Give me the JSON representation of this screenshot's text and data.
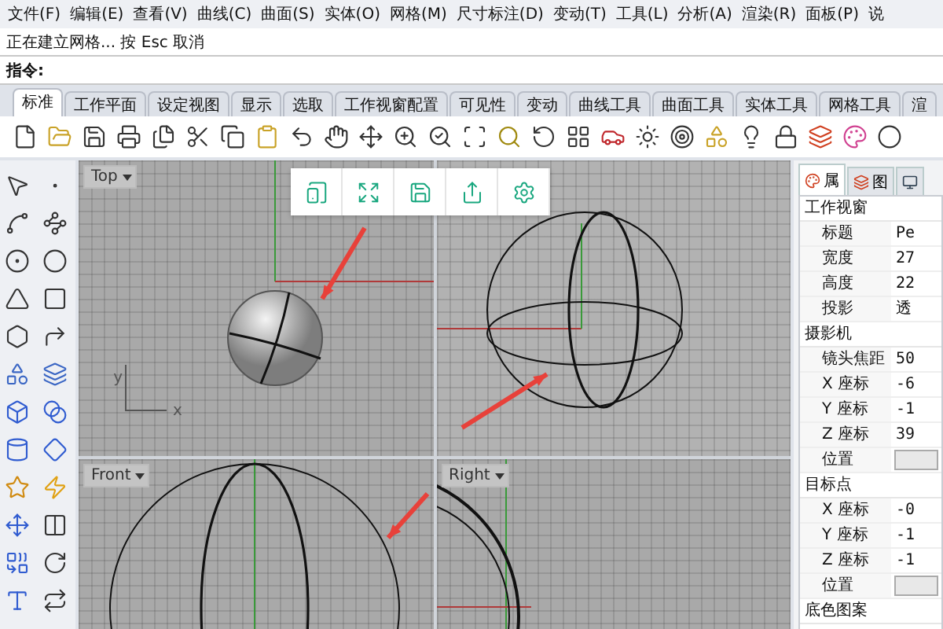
{
  "menu": [
    "文件(F)",
    "编辑(E)",
    "查看(V)",
    "曲线(C)",
    "曲面(S)",
    "实体(O)",
    "网格(M)",
    "尺寸标注(D)",
    "变动(T)",
    "工具(L)",
    "分析(A)",
    "渲染(R)",
    "面板(P)",
    "说"
  ],
  "command": {
    "history": "正在建立网格... 按 Esc 取消",
    "prompt": "指令:"
  },
  "tabs": [
    {
      "label": "标准",
      "selected": true
    },
    {
      "label": "工作平面",
      "selected": false
    },
    {
      "label": "设定视图",
      "selected": false
    },
    {
      "label": "显示",
      "selected": false
    },
    {
      "label": "选取",
      "selected": false
    },
    {
      "label": "工作视窗配置",
      "selected": false
    },
    {
      "label": "可见性",
      "selected": false
    },
    {
      "label": "变动",
      "selected": false
    },
    {
      "label": "曲线工具",
      "selected": false
    },
    {
      "label": "曲面工具",
      "selected": false
    },
    {
      "label": "实体工具",
      "selected": false
    },
    {
      "label": "网格工具",
      "selected": false
    },
    {
      "label": "渲",
      "selected": false
    }
  ],
  "viewports": [
    {
      "kind": "top",
      "label": "Top",
      "axis": {
        "x": "x",
        "y": "y"
      }
    },
    {
      "kind": "perspective"
    },
    {
      "kind": "front",
      "label": "Front"
    },
    {
      "kind": "right",
      "label": "Right"
    }
  ],
  "panel": {
    "tabs": [
      {
        "label": "属",
        "selected": true
      },
      {
        "label": "图",
        "selected": false
      },
      {
        "selected": false
      }
    ],
    "sections": [
      {
        "title": "工作视窗",
        "rows": [
          {
            "kind": "text",
            "label": "标题",
            "value": "Pe"
          },
          {
            "kind": "text",
            "label": "宽度",
            "value": "27"
          },
          {
            "kind": "text",
            "label": "高度",
            "value": "22"
          },
          {
            "kind": "text",
            "label": "投影",
            "value": "透"
          }
        ]
      },
      {
        "title": "摄影机",
        "rows": [
          {
            "kind": "text",
            "label": "镜头焦距",
            "value": "50"
          },
          {
            "kind": "text",
            "label": "X 座标",
            "value": "-6"
          },
          {
            "kind": "text",
            "label": "Y 座标",
            "value": "-1"
          },
          {
            "kind": "text",
            "label": "Z 座标",
            "value": "39"
          },
          {
            "kind": "button",
            "label": "位置"
          }
        ]
      },
      {
        "title": "目标点",
        "rows": [
          {
            "kind": "text",
            "label": "X 座标",
            "value": "-0"
          },
          {
            "kind": "text",
            "label": "Y 座标",
            "value": "-1"
          },
          {
            "kind": "text",
            "label": "Z 座标",
            "value": "-1"
          },
          {
            "kind": "button",
            "label": "位置"
          }
        ]
      },
      {
        "title": "底色图案"
      }
    ]
  }
}
